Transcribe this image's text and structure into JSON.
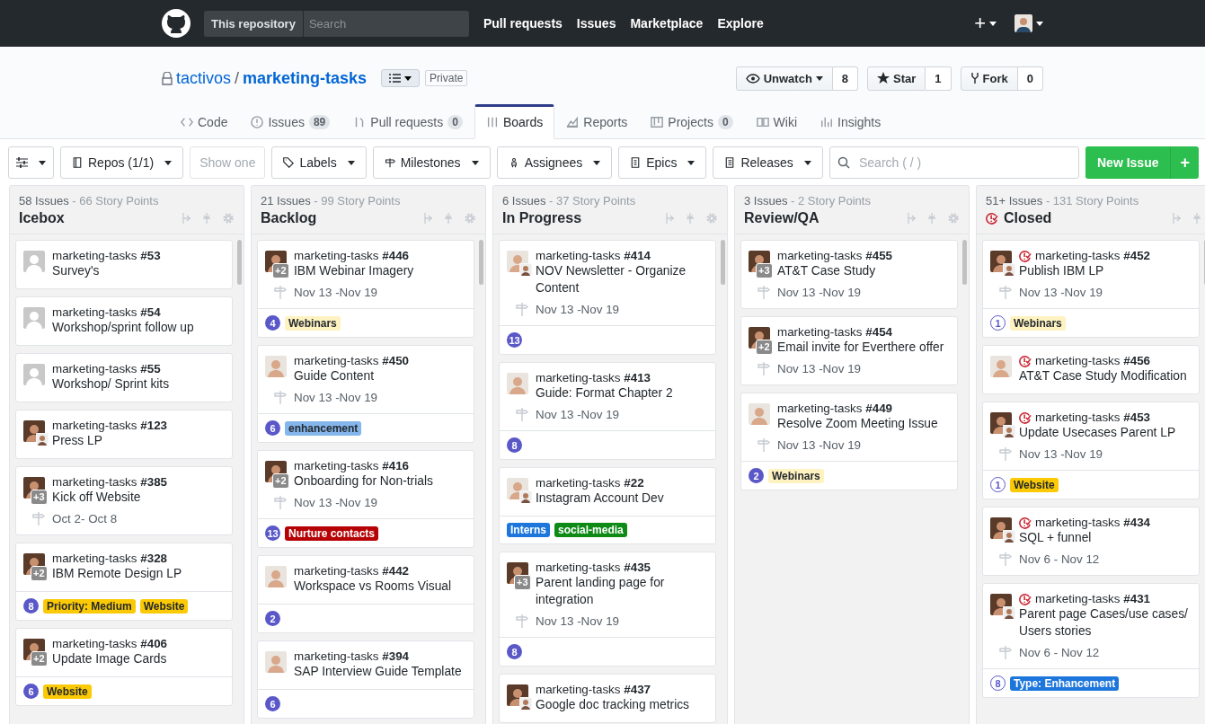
{
  "nav": {
    "scope": "This repository",
    "search_placeholder": "Search",
    "links": [
      "Pull requests",
      "Issues",
      "Marketplace",
      "Explore"
    ],
    "new_menu": "+"
  },
  "repo": {
    "owner": "tactivos",
    "separator": "/",
    "name": "marketing-tasks",
    "visibility": "Private",
    "actions": [
      {
        "kind": "watch",
        "label": "Unwatch",
        "count": "8"
      },
      {
        "kind": "star",
        "label": "Star",
        "count": "1"
      },
      {
        "kind": "fork",
        "label": "Fork",
        "count": "0"
      }
    ]
  },
  "tabs": [
    {
      "kind": "code",
      "label": "Code",
      "selected": false
    },
    {
      "kind": "issues",
      "label": "Issues",
      "count": "89",
      "selected": false
    },
    {
      "kind": "pulls",
      "label": "Pull requests",
      "count": "0",
      "selected": false
    },
    {
      "kind": "boards",
      "label": "Boards",
      "selected": true
    },
    {
      "kind": "reports",
      "label": "Reports",
      "selected": false
    },
    {
      "kind": "projects",
      "label": "Projects",
      "count": "0",
      "selected": false
    },
    {
      "kind": "wiki",
      "label": "Wiki",
      "selected": false
    },
    {
      "kind": "insights",
      "label": "Insights",
      "selected": false
    }
  ],
  "toolbar": {
    "filters": [
      {
        "kind": "repos",
        "label": "Repos (1/1)"
      },
      {
        "kind": "show",
        "label": "Show one"
      },
      {
        "kind": "labels",
        "label": "Labels"
      },
      {
        "kind": "milestones",
        "label": "Milestones"
      },
      {
        "kind": "assignees",
        "label": "Assignees"
      },
      {
        "kind": "epics",
        "label": "Epics"
      },
      {
        "kind": "releases",
        "label": "Releases"
      }
    ],
    "search_placeholder": "Search ( / )",
    "new_issue": "New Issue",
    "add": "+"
  },
  "columns": [
    {
      "issues": "58 Issues",
      "points": "- 66 Story Points",
      "title": "Icebox",
      "closed": false,
      "settings": true,
      "cards": [
        {
          "ref": "marketing-tasks",
          "number": "#53",
          "title": "Survey's",
          "avatar": {
            "kind": "blank",
            "second": false
          },
          "closed": false
        },
        {
          "ref": "marketing-tasks",
          "number": "#54",
          "title": "Workshop/sprint follow up",
          "avatar": {
            "kind": "blank",
            "second": false
          },
          "closed": false
        },
        {
          "ref": "marketing-tasks",
          "number": "#55",
          "title": "Workshop/ Sprint kits",
          "avatar": {
            "kind": "blank",
            "second": false
          },
          "closed": false
        },
        {
          "ref": "marketing-tasks",
          "number": "#123",
          "title": "Press LP",
          "avatar": {
            "kind": "dark",
            "second": true
          },
          "closed": false
        },
        {
          "ref": "marketing-tasks",
          "number": "#385",
          "title": "Kick off Website",
          "avatar": {
            "kind": "dark",
            "extra": "+3",
            "second": false
          },
          "date": "Oct 2- Oct 8",
          "closed": false
        },
        {
          "ref": "marketing-tasks",
          "number": "#328",
          "title": "IBM Remote Design LP",
          "avatar": {
            "kind": "dark",
            "extra": "+2",
            "second": false
          },
          "closed": false,
          "estimate": "8",
          "labels": [
            {
              "name": "Priority: Medium",
              "color": "#fbca04"
            },
            {
              "name": "Website",
              "color": "#fbca04"
            }
          ]
        },
        {
          "ref": "marketing-tasks",
          "number": "#406",
          "title": "Update Image Cards",
          "avatar": {
            "kind": "dark",
            "extra": "+2",
            "second": false
          },
          "closed": false,
          "estimate": "6",
          "labels": [
            {
              "name": "Website",
              "color": "#fbca04"
            }
          ]
        }
      ]
    },
    {
      "issues": "21 Issues",
      "points": "- 99 Story Points",
      "title": "Backlog",
      "closed": false,
      "settings": true,
      "cards": [
        {
          "ref": "marketing-tasks",
          "number": "#446",
          "title": "IBM Webinar Imagery",
          "avatar": {
            "kind": "dark",
            "extra": "+2",
            "second": false
          },
          "date": "Nov 13 -Nov 19",
          "closed": false,
          "estimate": "4",
          "labels": [
            {
              "name": "Webinars",
              "color": "#fef2c0"
            }
          ]
        },
        {
          "ref": "marketing-tasks",
          "number": "#450",
          "title": "Guide Content",
          "avatar": {
            "kind": "light",
            "second": false
          },
          "date": "Nov 13 -Nov 19",
          "closed": false,
          "estimate": "6",
          "labels": [
            {
              "name": "enhancement",
              "color": "#84b6eb"
            }
          ]
        },
        {
          "ref": "marketing-tasks",
          "number": "#416",
          "title": "Onboarding for Non-trials",
          "avatar": {
            "kind": "dark",
            "extra": "+2",
            "second": false
          },
          "date": "Nov 13 -Nov 19",
          "closed": false,
          "estimate": "13",
          "labels": [
            {
              "name": "Nurture contacts",
              "color": "#b60205"
            }
          ]
        },
        {
          "ref": "marketing-tasks",
          "number": "#442",
          "title": "Workspace vs Rooms Visual",
          "avatar": {
            "kind": "light",
            "second": false
          },
          "closed": false,
          "estimate": "2"
        },
        {
          "ref": "marketing-tasks",
          "number": "#394",
          "title": "SAP Interview Guide Template",
          "avatar": {
            "kind": "light",
            "second": false
          },
          "closed": false,
          "estimate": "6"
        }
      ]
    },
    {
      "issues": "6 Issues",
      "points": "- 37 Story Points",
      "title": "In Progress",
      "closed": false,
      "settings": true,
      "cards": [
        {
          "ref": "marketing-tasks",
          "number": "#414",
          "title": "NOV Newsletter - Organize Content",
          "avatar": {
            "kind": "light",
            "second": true
          },
          "date": "Nov 13 -Nov 19",
          "closed": false,
          "estimate": "13"
        },
        {
          "ref": "marketing-tasks",
          "number": "#413",
          "title": "Guide: Format Chapter 2",
          "avatar": {
            "kind": "light",
            "second": false
          },
          "date": "Nov 13 -Nov 19",
          "closed": false,
          "estimate": "8"
        },
        {
          "ref": "marketing-tasks",
          "number": "#22",
          "title": "Instagram Account Dev",
          "avatar": {
            "kind": "light",
            "second": true
          },
          "closed": false,
          "labels": [
            {
              "name": "Interns",
              "color": "#1d76db"
            },
            {
              "name": "social-media",
              "color": "#0e8a16"
            }
          ]
        },
        {
          "ref": "marketing-tasks",
          "number": "#435",
          "title": "Parent landing page for integration",
          "avatar": {
            "kind": "dark",
            "extra": "+3",
            "second": false
          },
          "date": "Nov 13 -Nov 19",
          "closed": false,
          "estimate": "8"
        },
        {
          "ref": "marketing-tasks",
          "number": "#437",
          "title": "Google doc tracking metrics",
          "avatar": {
            "kind": "dark",
            "second": true
          },
          "closed": false
        }
      ]
    },
    {
      "issues": "3 Issues",
      "points": "- 2 Story Points",
      "title": "Review/QA",
      "closed": false,
      "settings": true,
      "cards": [
        {
          "ref": "marketing-tasks",
          "number": "#455",
          "title": "AT&T Case Study",
          "avatar": {
            "kind": "dark",
            "extra": "+3",
            "second": false
          },
          "date": "Nov 13 -Nov 19",
          "closed": false
        },
        {
          "ref": "marketing-tasks",
          "number": "#454",
          "title": "Email invite for Everthere offer",
          "avatar": {
            "kind": "dark",
            "extra": "+2",
            "second": false
          },
          "date": "Nov 13 -Nov 19",
          "closed": false
        },
        {
          "ref": "marketing-tasks",
          "number": "#449",
          "title": "Resolve Zoom Meeting Issue",
          "avatar": {
            "kind": "light",
            "second": false
          },
          "date": "Nov 13 -Nov 19",
          "closed": false,
          "estimate": "2",
          "labels": [
            {
              "name": "Webinars",
              "color": "#fef2c0"
            }
          ]
        }
      ]
    },
    {
      "issues": "51+ Issues",
      "points": "- 131 Story Points",
      "title": "Closed",
      "closed": true,
      "settings": false,
      "cards": [
        {
          "ref": "marketing-tasks",
          "number": "#452",
          "title": "Publish IBM LP",
          "avatar": {
            "kind": "dark",
            "second": true
          },
          "date": "Nov 13 -Nov 19",
          "closed": true,
          "estimate": "1",
          "labels": [
            {
              "name": "Webinars",
              "color": "#fef2c0"
            }
          ]
        },
        {
          "ref": "marketing-tasks",
          "number": "#456",
          "title": "AT&T Case Study Modification",
          "avatar": {
            "kind": "light",
            "second": false
          },
          "closed": true
        },
        {
          "ref": "marketing-tasks",
          "number": "#453",
          "title": "Update Usecases Parent LP",
          "avatar": {
            "kind": "dark",
            "second": true
          },
          "date": "Nov 13 -Nov 19",
          "closed": true,
          "estimate": "1",
          "labels": [
            {
              "name": "Website",
              "color": "#fbca04"
            }
          ]
        },
        {
          "ref": "marketing-tasks",
          "number": "#434",
          "title": "SQL + funnel",
          "avatar": {
            "kind": "dark",
            "second": true
          },
          "date": "Nov 6 - Nov 12",
          "closed": true
        },
        {
          "ref": "marketing-tasks",
          "number": "#431",
          "title": "Parent page Cases/use cases/ Users stories",
          "avatar": {
            "kind": "dark",
            "second": true
          },
          "date": "Nov 6 - Nov 12",
          "closed": true,
          "estimate": "8",
          "labels": [
            {
              "name": "Type: Enhancement",
              "color": "#1d76db"
            }
          ]
        }
      ]
    }
  ]
}
